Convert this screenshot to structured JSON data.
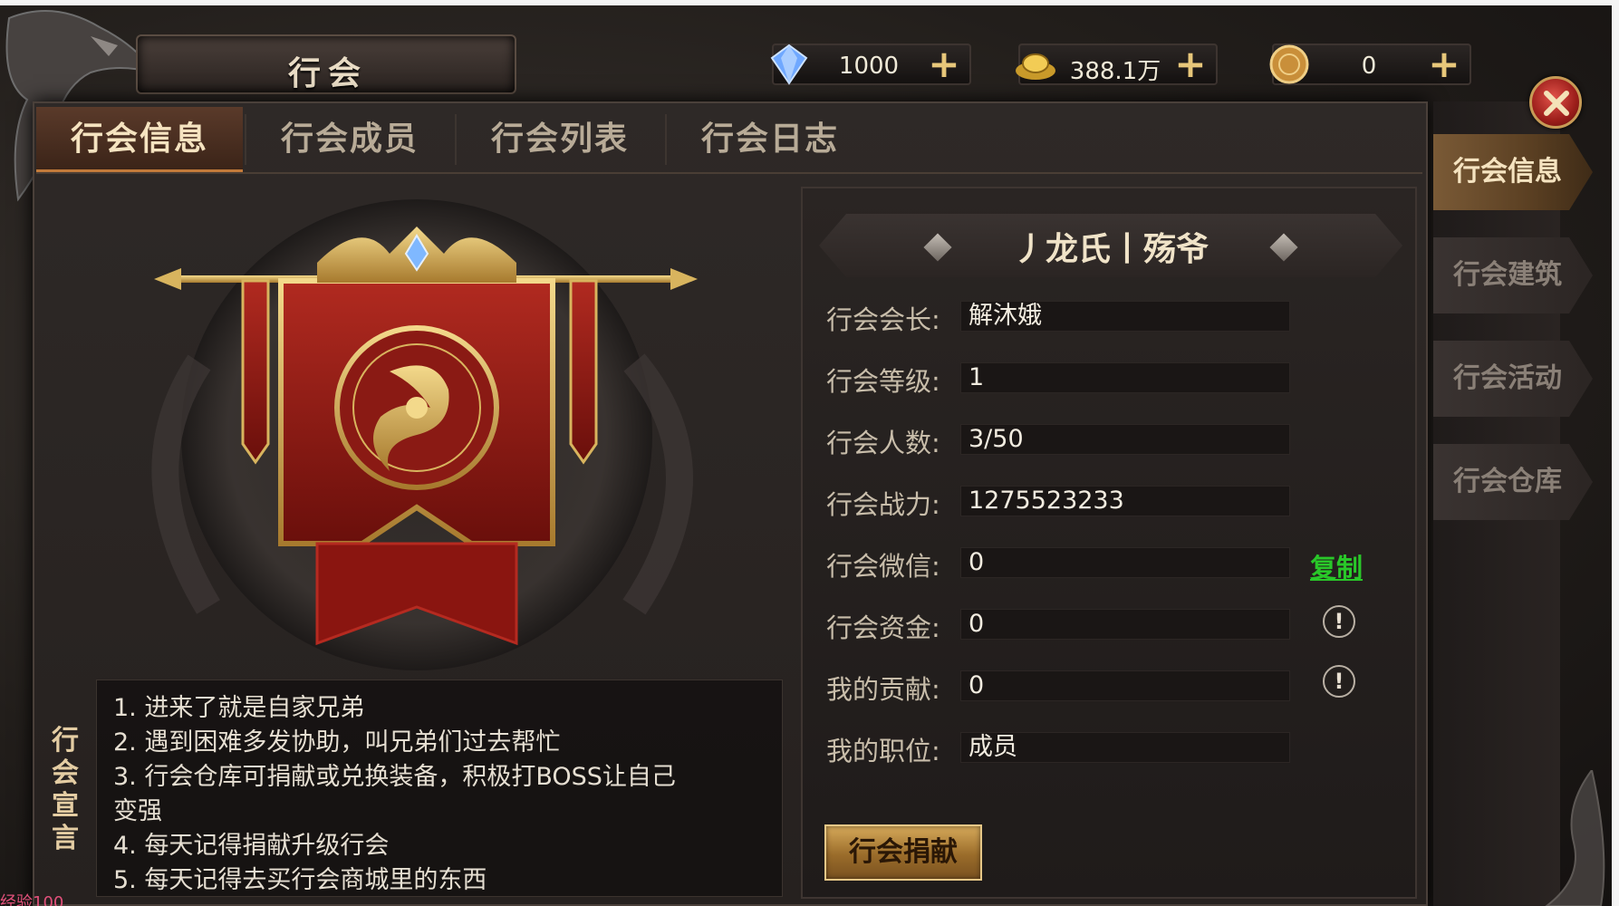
{
  "window": {
    "title": "行会"
  },
  "currencies": [
    {
      "icon": "diamond-icon",
      "value": "1000"
    },
    {
      "icon": "gold-ingot-icon",
      "value": "388.1万"
    },
    {
      "icon": "coin-icon",
      "value": "0"
    }
  ],
  "tabs": [
    {
      "label": "行会信息",
      "active": true
    },
    {
      "label": "行会成员",
      "active": false
    },
    {
      "label": "行会列表",
      "active": false
    },
    {
      "label": "行会日志",
      "active": false
    }
  ],
  "side_tabs": [
    {
      "label": "行会信息",
      "active": true
    },
    {
      "label": "行会建筑",
      "active": false
    },
    {
      "label": "行会活动",
      "active": false
    },
    {
      "label": "行会仓库",
      "active": false
    }
  ],
  "guild": {
    "name": "丿龙氏丨殇爷",
    "rows": [
      {
        "label": "行会会长:",
        "value": "解沐娥"
      },
      {
        "label": "行会等级:",
        "value": "1"
      },
      {
        "label": "行会人数:",
        "value": "3/50"
      },
      {
        "label": "行会战力:",
        "value": "1275523233"
      },
      {
        "label": "行会微信:",
        "value": "0"
      },
      {
        "label": "行会资金:",
        "value": "0"
      },
      {
        "label": "我的贡献:",
        "value": "0"
      },
      {
        "label": "我的职位:",
        "value": "成员"
      }
    ],
    "copy_label": "复制",
    "info_symbol": "!",
    "donate_label": "行会捐献"
  },
  "declaration": {
    "label": "行会宣言",
    "lines": [
      "1. 进来了就是自家兄弟",
      "2. 遇到困难多发协助，叫兄弟们过去帮忙",
      "3. 行会仓库可捐献或兑换装备，积极打BOSS让自己",
      "变强",
      "4. 每天记得捐献升级行会",
      "5. 每天记得去买行会商城里的东西"
    ]
  },
  "bottom_text": "经验100",
  "colors": {
    "accent_gold": "#d6a95a",
    "tab_active": "#5a3a2a",
    "copy_green": "#29c829",
    "banner_red": "#a01d16"
  }
}
